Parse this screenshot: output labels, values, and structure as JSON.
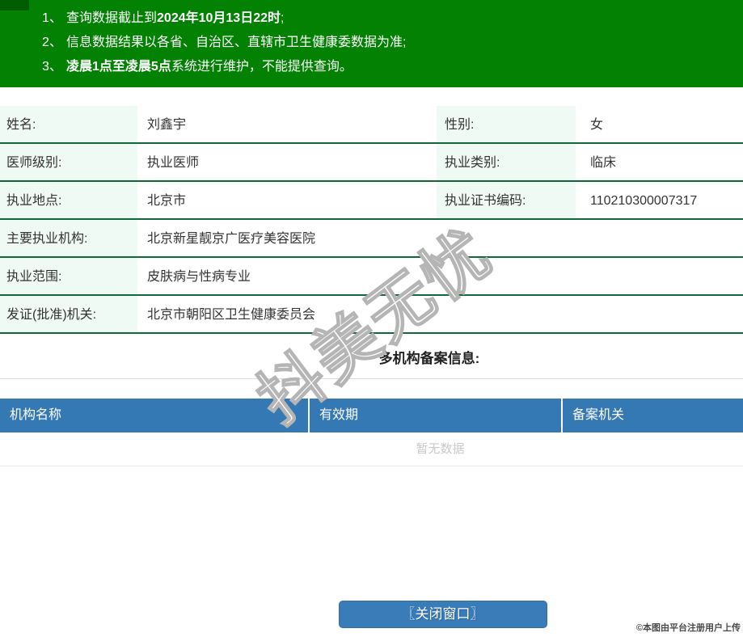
{
  "banner": {
    "lines": [
      {
        "num": "1、",
        "pre": "查询数据截止到",
        "bold": "2024年10月13日22时",
        "post": ";"
      },
      {
        "num": "2、",
        "pre": "信息数据结果以各省、自治区、直辖市卫生健康委数据为准;",
        "bold": "",
        "post": ""
      },
      {
        "num": "3、",
        "pre": "",
        "bold": "凌晨1点至凌晨5点",
        "post": "系统进行维护，不能提供查询。"
      }
    ]
  },
  "doctor": {
    "rows4": [
      {
        "l1": "姓名:",
        "v1": "刘鑫宇",
        "l2": "性别:",
        "v2": "女"
      },
      {
        "l1": "医师级别:",
        "v1": "执业医师",
        "l2": "执业类别:",
        "v2": "临床"
      },
      {
        "l1": "执业地点:",
        "v1": "北京市",
        "l2": "执业证书编码:",
        "v2": "110210300007317"
      }
    ],
    "rows2": [
      {
        "l1": "主要执业机构:",
        "v1": "北京新星靓京广医疗美容医院"
      },
      {
        "l1": "执业范围:",
        "v1": "皮肤病与性病专业"
      },
      {
        "l1": "发证(批准)机关:",
        "v1": "北京市朝阳区卫生健康委员会"
      }
    ]
  },
  "filing": {
    "heading": "多机构备案信息:",
    "columns": [
      "机构名称",
      "有效期",
      "备案机关"
    ],
    "empty": "暂无数据"
  },
  "close_button": "〖关闭窗口〗",
  "credit": "©本图由平台注册用户上传",
  "watermark": "抖美无忧",
  "colors": {
    "banner_green": "#028102",
    "row_border_green": "#10693a",
    "label_bg_green": "#effaf4",
    "header_blue": "#3579b4",
    "button_blue": "#3a7cb8",
    "empty_text_gray": "#c9c9c9"
  }
}
